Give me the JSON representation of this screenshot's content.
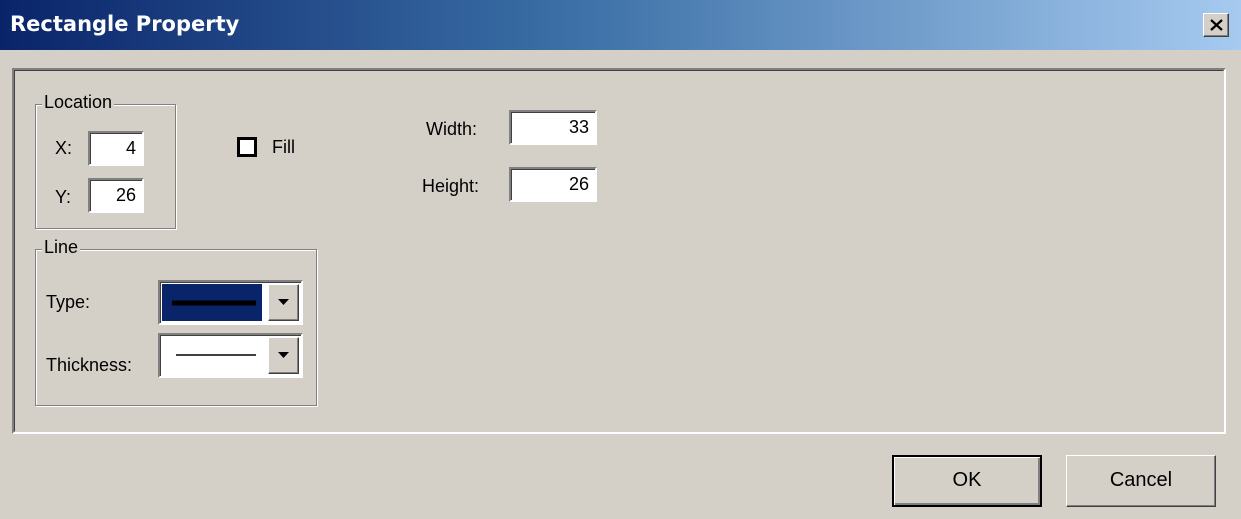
{
  "window": {
    "title": "Rectangle Property"
  },
  "location": {
    "legend": "Location",
    "x_label": "X:",
    "x_value": "4",
    "y_label": "Y:",
    "y_value": "26"
  },
  "fill": {
    "label": "Fill",
    "checked": false
  },
  "size": {
    "width_label": "Width:",
    "width_value": "33",
    "height_label": "Height:",
    "height_value": "26"
  },
  "line": {
    "legend": "Line",
    "type_label": "Type:",
    "thickness_label": "Thickness:"
  },
  "buttons": {
    "ok": "OK",
    "cancel": "Cancel"
  },
  "colors": {
    "selection": "#0a246a",
    "titlebar_start": "#0a246a",
    "titlebar_end": "#a6caf0"
  }
}
